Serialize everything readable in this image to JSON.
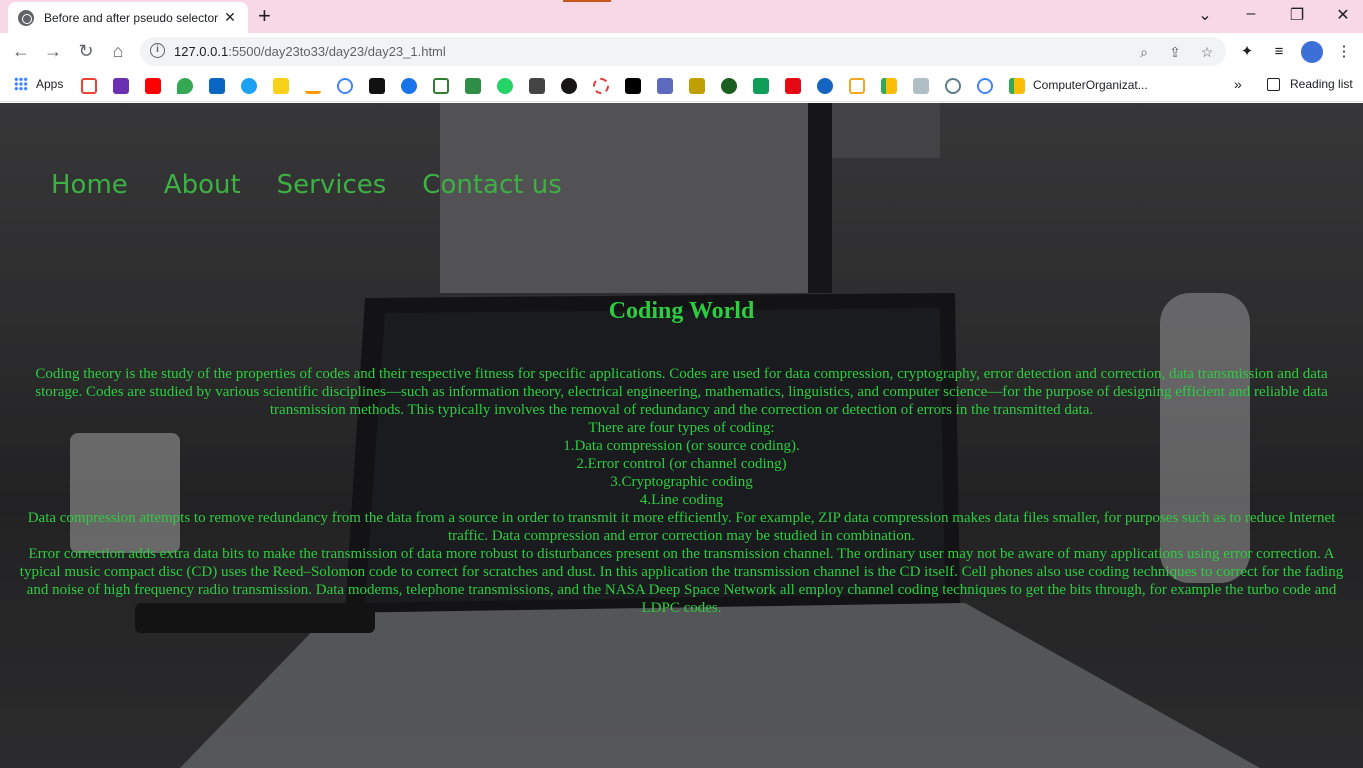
{
  "browser": {
    "tab_title": "Before and after pseudo selector",
    "tab_close": "✕",
    "new_tab": "+",
    "url_host": "127.0.0.1",
    "url_rest": ":5500/day23to33/day23/day23_1.html",
    "bookmarks": {
      "apps_label": "Apps",
      "computer_org_label": "ComputerOrganizat...",
      "more": "»",
      "reading_list": "Reading list"
    }
  },
  "nav": {
    "items": [
      "Home",
      "About",
      "Services",
      "Contact us"
    ]
  },
  "content": {
    "heading": "Coding World",
    "para1": "Coding theory is the study of the properties of codes and their respective fitness for specific applications. Codes are used for data compression, cryptography, error detection and correction, data transmission and data storage. Codes are studied by various scientific disciplines—such as information theory, electrical engineering, mathematics, linguistics, and computer science—for the purpose of designing efficient and reliable data transmission methods. This typically involves the removal of redundancy and the correction or detection of errors in the transmitted data.",
    "types_intro": "There are four types of coding:",
    "types": [
      "1.Data compression (or source coding).",
      "2.Error control (or channel coding)",
      "3.Cryptographic coding",
      "4.Line coding"
    ],
    "para2": "Data compression attempts to remove redundancy from the data from a source in order to transmit it more efficiently. For example, ZIP data compression makes data files smaller, for purposes such as to reduce Internet traffic. Data compression and error correction may be studied in combination.",
    "para3": "Error correction adds extra data bits to make the transmission of data more robust to disturbances present on the transmission channel. The ordinary user may not be aware of many applications using error correction. A typical music compact disc (CD) uses the Reed–Solomon code to correct for scratches and dust. In this application the transmission channel is the CD itself. Cell phones also use coding techniques to correct for the fading and noise of high frequency radio transmission. Data modems, telephone transmissions, and the NASA Deep Space Network all employ channel coding techniques to get the bits through, for example the turbo code and LDPC codes."
  },
  "colors": {
    "text_green": "#2ecc40",
    "nav_green": "#3cb043",
    "tabstrip": "#f8d7e6"
  }
}
